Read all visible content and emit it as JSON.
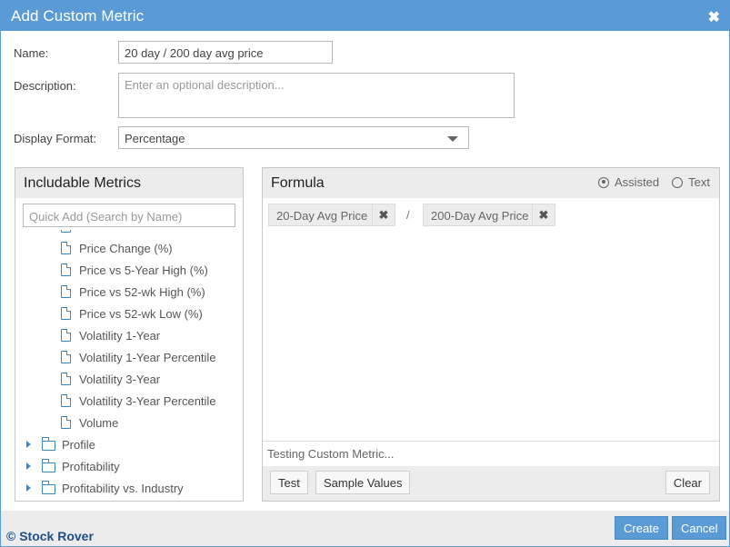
{
  "dialog": {
    "title": "Add Custom Metric",
    "close_glyph": "✖"
  },
  "form": {
    "name_label": "Name:",
    "name_value": "20 day / 200 day avg price",
    "description_label": "Description:",
    "description_placeholder": "Enter an optional description...",
    "display_format_label": "Display Format:",
    "display_format_value": "Percentage"
  },
  "includable": {
    "title": "Includable Metrics",
    "search_placeholder": "Quick Add (Search by Name)",
    "metrics": [
      "Price Change (%)",
      "Price vs 5-Year High (%)",
      "Price vs 52-wk High (%)",
      "Price vs 52-wk Low (%)",
      "Volatility 1-Year",
      "Volatility 1-Year Percentile",
      "Volatility 3-Year",
      "Volatility 3-Year Percentile",
      "Volume"
    ],
    "folders": [
      "Profile",
      "Profitability",
      "Profitability vs. Industry"
    ]
  },
  "formula": {
    "title": "Formula",
    "mode_assisted": "Assisted",
    "mode_text": "Text",
    "term1": "20-Day Avg Price",
    "operator": "/",
    "term2": "200-Day Avg Price",
    "remove_glyph": "✖",
    "testing_text": "Testing Custom Metric...",
    "test_label": "Test",
    "sample_values_label": "Sample Values",
    "clear_label": "Clear"
  },
  "footer": {
    "brand": "© Stock Rover",
    "create_label": "Create",
    "cancel_label": "Cancel"
  },
  "colors": {
    "accent": "#5b9bd5",
    "icon_blue": "#3d87c9",
    "panel_gray": "#ececec"
  }
}
